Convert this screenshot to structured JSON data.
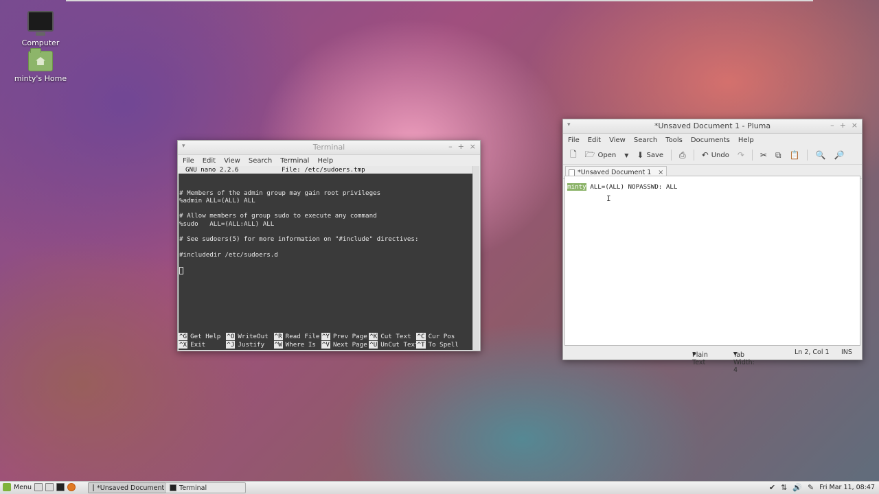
{
  "desktop": {
    "icons": [
      {
        "label": "Computer"
      },
      {
        "label": "minty's Home"
      }
    ]
  },
  "terminal": {
    "title": "Terminal",
    "menu": [
      "File",
      "Edit",
      "View",
      "Search",
      "Terminal",
      "Help"
    ],
    "nano_version": "GNU nano 2.2.6",
    "nano_file": "File: /etc/sudoers.tmp",
    "lines": [
      "",
      "",
      "# Members of the admin group may gain root privileges",
      "%admin ALL=(ALL) ALL",
      "",
      "# Allow members of group sudo to execute any command",
      "%sudo   ALL=(ALL:ALL) ALL",
      "",
      "# See sudoers(5) for more information on \"#include\" directives:",
      "",
      "#includedir /etc/sudoers.d"
    ],
    "shortcuts_row1": [
      {
        "key": "^G",
        "label": "Get Help"
      },
      {
        "key": "^O",
        "label": "WriteOut"
      },
      {
        "key": "^R",
        "label": "Read File"
      },
      {
        "key": "^Y",
        "label": "Prev Page"
      },
      {
        "key": "^K",
        "label": "Cut Text"
      },
      {
        "key": "^C",
        "label": "Cur Pos"
      }
    ],
    "shortcuts_row2": [
      {
        "key": "^X",
        "label": "Exit"
      },
      {
        "key": "^J",
        "label": "Justify"
      },
      {
        "key": "^W",
        "label": "Where Is"
      },
      {
        "key": "^V",
        "label": "Next Page"
      },
      {
        "key": "^U",
        "label": "UnCut Text"
      },
      {
        "key": "^T",
        "label": "To Spell"
      }
    ]
  },
  "pluma": {
    "title": "*Unsaved Document 1 - Pluma",
    "menu": [
      "File",
      "Edit",
      "View",
      "Search",
      "Tools",
      "Documents",
      "Help"
    ],
    "toolbar": {
      "open_label": "Open",
      "save_label": "Save",
      "undo_label": "Undo"
    },
    "tab_label": "*Unsaved Document 1",
    "editor": {
      "selected_text": "minty",
      "rest_text": " ALL=(ALL) NOPASSWD: ALL"
    },
    "status": {
      "language": "Plain Text",
      "tab_width": "Tab Width: 4",
      "position": "Ln 2, Col 1",
      "mode": "INS"
    }
  },
  "taskbar": {
    "menu_label": "Menu",
    "tasks": [
      {
        "label": "*Unsaved Document ..."
      },
      {
        "label": "Terminal"
      }
    ],
    "clock": "Fri Mar 11, 08:47"
  }
}
